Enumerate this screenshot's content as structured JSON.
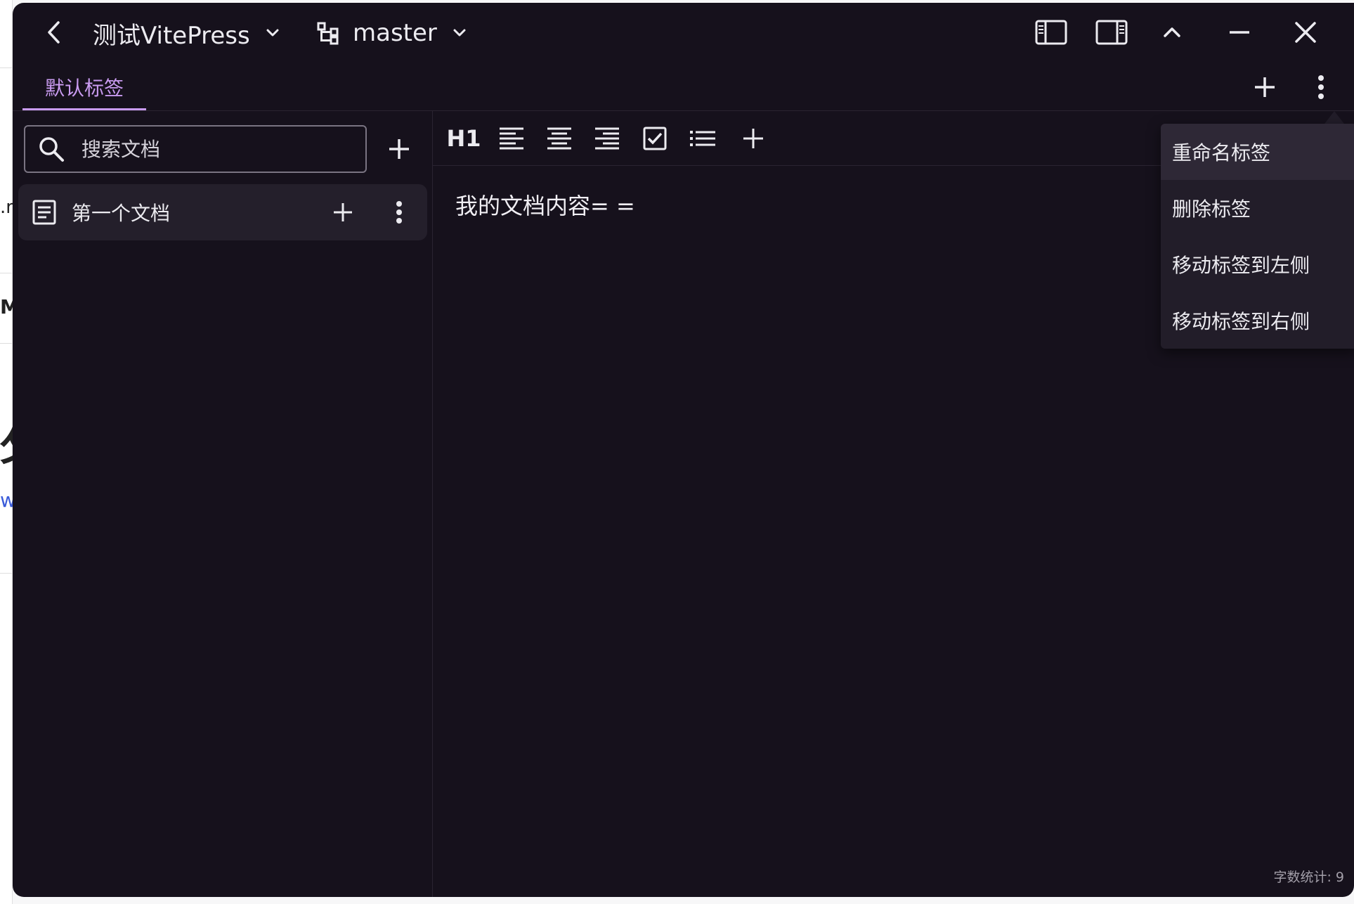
{
  "background": {
    "fragments": [
      ".n",
      "M",
      "攵",
      "w"
    ]
  },
  "titlebar": {
    "project_name": "测试VitePress",
    "branch_name": "master"
  },
  "tabs": [
    {
      "label": "默认标签",
      "active": true
    }
  ],
  "sidebar": {
    "search_placeholder": "搜索文档",
    "documents": [
      {
        "title": "第一个文档"
      }
    ]
  },
  "toolbar": {
    "heading_label": "H1"
  },
  "editor": {
    "content": "我的文档内容= =",
    "word_count": "字数统计: 9"
  },
  "tab_menu": {
    "items": [
      {
        "label": "重命名标签",
        "highlighted": true
      },
      {
        "label": "删除标签"
      },
      {
        "label": "移动标签到左侧"
      },
      {
        "label": "移动标签到右侧"
      }
    ]
  },
  "colors": {
    "window_bg": "#16111c",
    "accent": "#c99bf0",
    "item_bg": "#241f2b",
    "menu_bg": "#221d29"
  }
}
